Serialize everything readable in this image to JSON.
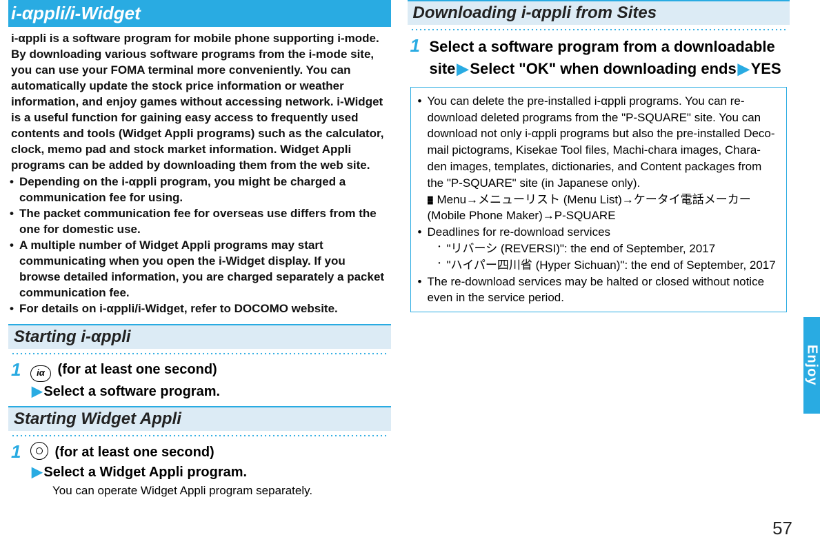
{
  "left": {
    "banner": "i-αppli/i-Widget",
    "intro": "i-αppli is a software program for mobile phone supporting i-mode. By downloading various software programs from the i-mode site, you can use your FOMA terminal more conveniently. You can automatically update the stock price information or weather information, and enjoy games without accessing network. i-Widget is a useful function for gaining easy access to frequently used contents and tools (Widget Appli programs) such as the calculator, clock, memo pad and stock market information. Widget Appli programs can be added by downloading them from the web site.",
    "bullets": [
      "Depending on the i-αppli program, you might be charged a communication fee for using.",
      "The packet communication fee for overseas use differs from the one for domestic use.",
      "A multiple number of Widget Appli programs may start communicating when you open the i-Widget display. If you browse detailed information, you are charged separately a packet communication fee.",
      "For details on i-αppli/i-Widget, refer to DOCOMO website."
    ],
    "section1": {
      "title": "Starting i-αppli",
      "step_num": "1",
      "step_a": " (for at least one second)",
      "step_b": "Select a software program."
    },
    "section2": {
      "title": "Starting Widget Appli",
      "step_num": "1",
      "step_a": " (for at least one second)",
      "step_b": "Select a Widget Appli program.",
      "note": "You can operate Widget Appli program separately."
    }
  },
  "right": {
    "title": "Downloading i-αppli from Sites",
    "step_num": "1",
    "step_parts": {
      "a": "Select a software program from a downloadable site",
      "b": "Select \"OK\" when downloading ends",
      "c": "YES"
    },
    "box": {
      "p1": "You can delete the pre-installed i-αppli programs. You can re-download deleted programs from the \"P-SQUARE\" site. You can download not only i-αppli programs but also the pre-installed Deco-mail pictograms, Kisekae Tool files, Machi-chara images, Chara-den images, templates, dictionaries, and Content packages from the \"P-SQUARE\" site (in Japanese only).",
      "menu_path": "Menu→メニューリスト (Menu List)→ケータイ電話メーカー (Mobile Phone Maker)→P-SQUARE",
      "p2_head": "Deadlines for re-download services",
      "p2_items": [
        "\"リバーシ (REVERSI)\": the end of September, 2017",
        "\"ハイパー四川省 (Hyper Sichuan)\": the end of September, 2017"
      ],
      "p3": "The re-download services may be halted or closed without notice even in the service period."
    }
  },
  "side_tab": "Enjoy",
  "page_number": "57"
}
